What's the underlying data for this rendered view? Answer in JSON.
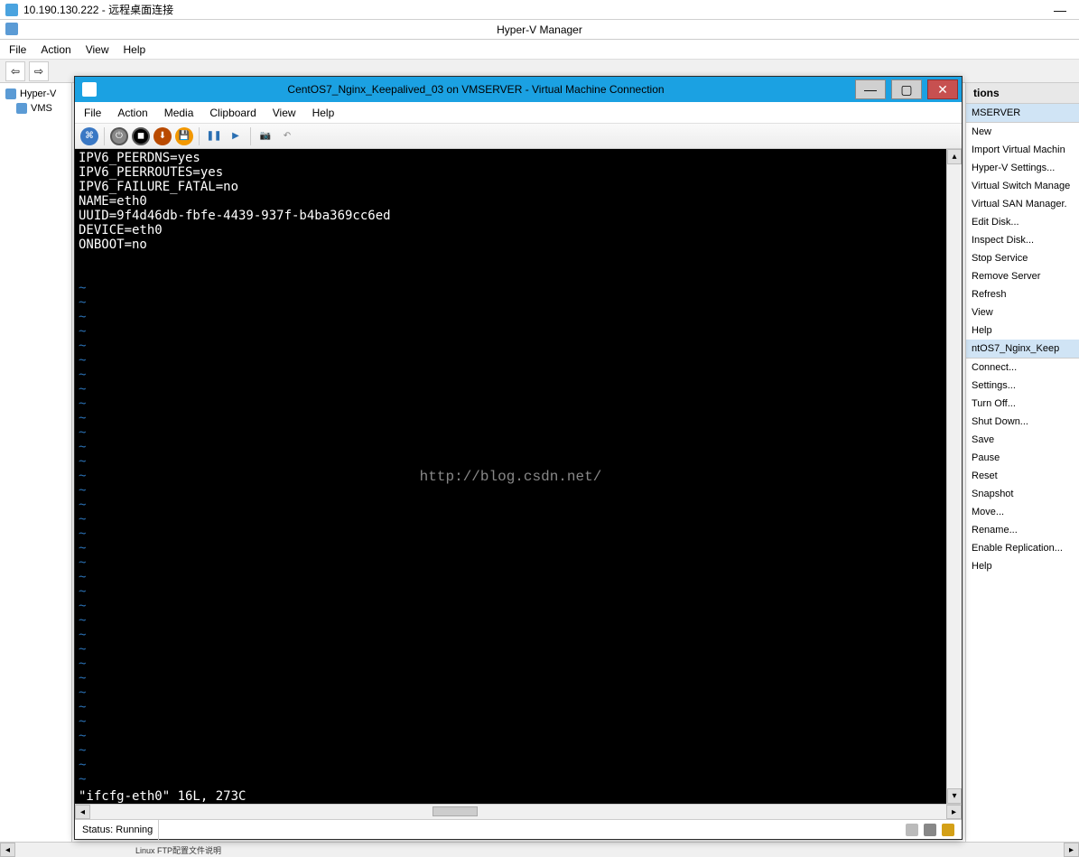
{
  "rdp": {
    "title": "10.190.130.222 - 远程桌面连接"
  },
  "hvm": {
    "title": "Hyper-V Manager",
    "menu": {
      "file": "File",
      "action": "Action",
      "view": "View",
      "help": "Help"
    },
    "tree": {
      "root": "Hyper-V",
      "server": "VMS"
    }
  },
  "actions": {
    "header": "tions",
    "group1": "MSERVER",
    "items1": [
      "New",
      "Import Virtual Machin",
      "Hyper-V Settings...",
      "Virtual Switch Manage",
      "Virtual SAN Manager.",
      "Edit Disk...",
      "Inspect Disk...",
      "Stop Service",
      "Remove Server",
      "Refresh",
      "View",
      "Help"
    ],
    "group2": "ntOS7_Nginx_Keep",
    "items2": [
      "Connect...",
      "Settings...",
      "Turn Off...",
      "Shut Down...",
      "Save",
      "Pause",
      "Reset",
      "Snapshot",
      "Move...",
      "Rename...",
      "Enable Replication...",
      "Help"
    ]
  },
  "vmc": {
    "title": "CentOS7_Nginx_Keepalived_03 on VMSERVER - Virtual Machine Connection",
    "menu": {
      "file": "File",
      "action": "Action",
      "media": "Media",
      "clipboard": "Clipboard",
      "view": "View",
      "help": "Help"
    },
    "console_lines": [
      "IPV6_PEERDNS=yes",
      "IPV6_PEERROUTES=yes",
      "IPV6_FAILURE_FATAL=no",
      "NAME=eth0",
      "UUID=9f4d46db-fbfe-4439-937f-b4ba369cc6ed",
      "DEVICE=eth0",
      "ONBOOT=no"
    ],
    "watermark": "http://blog.csdn.net/",
    "vi_status": "\"ifcfg-eth0\" 16L, 273C",
    "status": "Status: Running"
  },
  "partial": "Linux FTP配置文件说明"
}
